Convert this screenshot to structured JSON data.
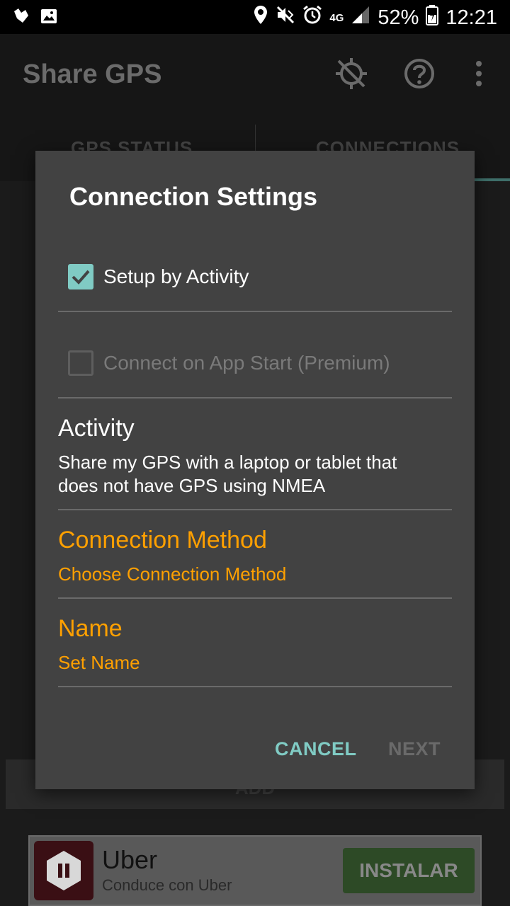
{
  "status_bar": {
    "battery": "52%",
    "time": "12:21",
    "network": "4G"
  },
  "app_bar": {
    "title": "Share GPS"
  },
  "tabs": [
    {
      "label": "GPS STATUS"
    },
    {
      "label": "CONNECTIONS"
    }
  ],
  "add_button": "ADD",
  "ad": {
    "title": "Uber",
    "subtitle": "Conduce con Uber",
    "cta": "INSTALAR"
  },
  "dialog": {
    "title": "Connection Settings",
    "setup_by_activity": {
      "label": "Setup by Activity",
      "checked": true
    },
    "connect_on_start": {
      "label": "Connect on App Start (Premium)",
      "checked": false
    },
    "activity": {
      "title": "Activity",
      "value": "Share my GPS with a laptop or tablet that does not have GPS using NMEA"
    },
    "connection_method": {
      "title": "Connection Method",
      "value": "Choose Connection Method"
    },
    "name": {
      "title": "Name",
      "value": "Set Name"
    },
    "cancel": "CANCEL",
    "next": "NEXT"
  },
  "colors": {
    "accent": "#80cbc4",
    "orange": "#ffa000",
    "dialog_bg": "#424242"
  }
}
